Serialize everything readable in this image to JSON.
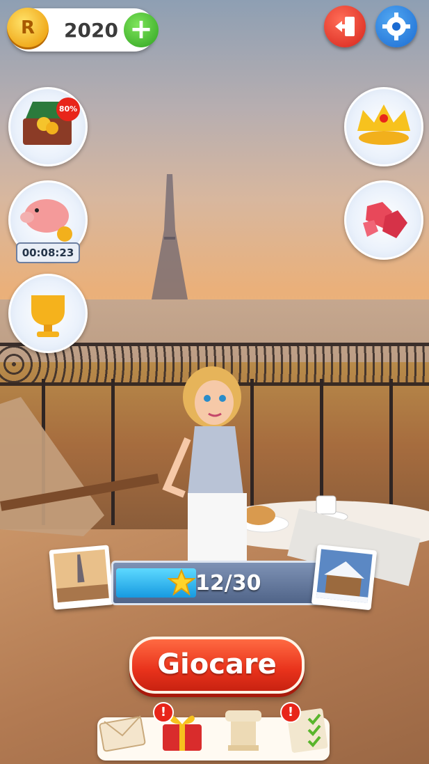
{
  "hud": {
    "coin_letter": "R",
    "coins": "2020",
    "add_coins": "+"
  },
  "side": {
    "sale_badge": "80%",
    "piggy_timer": "00:08:23"
  },
  "level": {
    "progress_text": "12/30",
    "progress_fraction": 0.4
  },
  "play_button": {
    "label": "Giocare"
  },
  "bottom_nav": {
    "alert_mark": "!"
  },
  "colors": {
    "accent_red": "#e8321b",
    "accent_blue": "#1b6bd2",
    "accent_green": "#2fa321",
    "gold": "#f0a91b"
  }
}
